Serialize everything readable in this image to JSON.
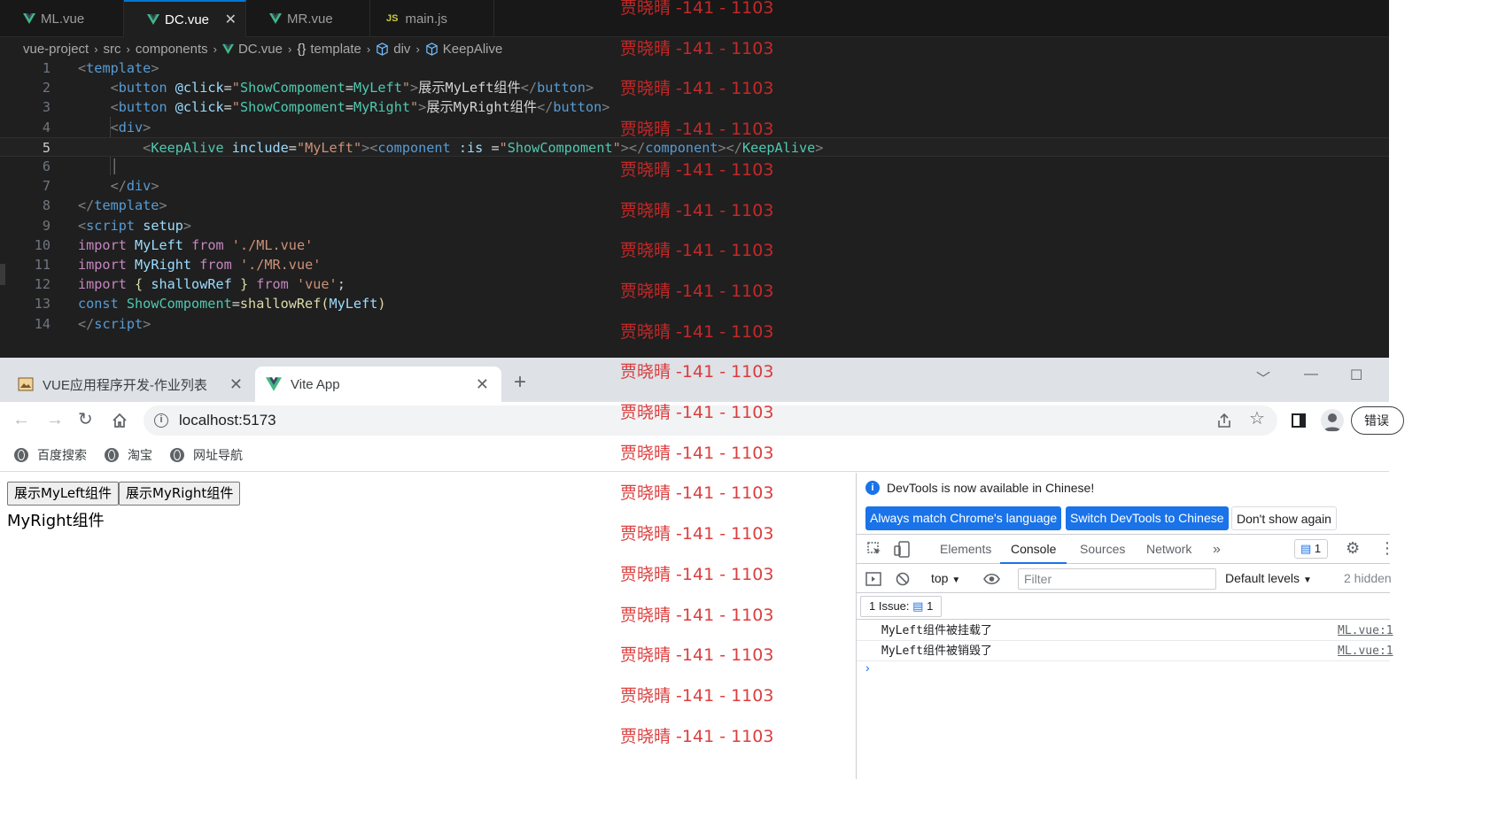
{
  "editor": {
    "tabs": [
      {
        "label": "ML.vue",
        "icon": "vue-icon",
        "active": false
      },
      {
        "label": "DC.vue",
        "icon": "vue-icon",
        "active": true
      },
      {
        "label": "MR.vue",
        "icon": "vue-icon",
        "active": false
      },
      {
        "label": "main.js",
        "icon": "js-icon",
        "badge": "JS",
        "active": false
      }
    ],
    "close_glyph": "✕",
    "breadcrumb": [
      "vue-project",
      "src",
      "components",
      "DC.vue",
      "template",
      "div",
      "KeepAlive"
    ],
    "current_line": 5,
    "line_numbers": [
      "1",
      "2",
      "3",
      "4",
      "5",
      "6",
      "7",
      "8",
      "9",
      "10",
      "11",
      "12",
      "13",
      "14"
    ]
  },
  "browser": {
    "tabs": [
      {
        "label": "VUE应用程序开发-作业列表",
        "active": false
      },
      {
        "label": "Vite App",
        "active": true
      }
    ],
    "url": "localhost:5173",
    "error_button": "错误",
    "bookmarks": [
      "百度搜索",
      "淘宝",
      "网址导航"
    ]
  },
  "page": {
    "buttons": [
      "展示MyLeft组件",
      "展示MyRight组件"
    ],
    "component_text": "MyRight组件"
  },
  "devtools": {
    "banner_message": "DevTools is now available in Chinese!",
    "banner_buttons": [
      "Always match Chrome's language",
      "Switch DevTools to Chinese",
      "Don't show again"
    ],
    "tabs": [
      "Elements",
      "Console",
      "Sources",
      "Network"
    ],
    "active_tab": "Console",
    "issue_badge_count": "1",
    "context": "top",
    "filter_placeholder": "Filter",
    "levels": "Default levels",
    "hidden": "2 hidden",
    "issues_label": "1 Issue:",
    "issues_count": "1",
    "logs": [
      {
        "message": "MyLeft组件被挂载了",
        "source": "ML.vue:1"
      },
      {
        "message": "MyLeft组件被销毁了",
        "source": "ML.vue:1"
      }
    ],
    "prompt": "›"
  },
  "watermark": {
    "text": "贾晓晴 -141 - 1103",
    "count": 19
  },
  "colors": {
    "vscode_bg": "#1f1f1f",
    "tag": "#569cd6",
    "attribute": "#9cdcfe",
    "string": "#ce9178",
    "keyword": "#c586c0",
    "component": "#4ec9b0",
    "function": "#dcdcaa",
    "accent_blue": "#1a73e8",
    "watermark": "#d92a2a",
    "vue_green": "#41b883"
  }
}
